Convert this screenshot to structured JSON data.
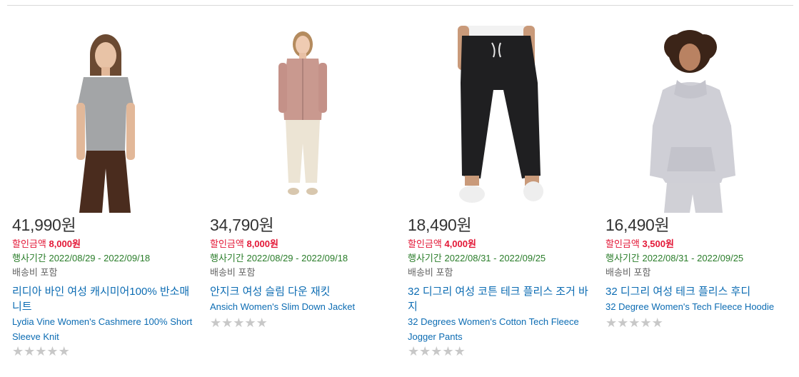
{
  "products": [
    {
      "price": "41,990원",
      "discount_label": "할인금액",
      "discount_value": "8,000원",
      "period_label": "행사기간",
      "period": "2022/08/29 - 2022/09/18",
      "shipping": "배송비 포함",
      "title_ko": "리디아 바인 여성 캐시미어100% 반소매 니트",
      "title_en": "Lydia Vine Women's Cashmere 100% Short Sleeve Knit",
      "rating_stars": 0,
      "image_icon": "product-image-cashmere-knit"
    },
    {
      "price": "34,790원",
      "discount_label": "할인금액",
      "discount_value": "8,000원",
      "period_label": "행사기간",
      "period": "2022/08/29 - 2022/09/18",
      "shipping": "배송비 포함",
      "title_ko": "안지크 여성 슬림 다운 재킷",
      "title_en": "Ansich Women's Slim Down Jacket",
      "rating_stars": 0,
      "image_icon": "product-image-down-jacket"
    },
    {
      "price": "18,490원",
      "discount_label": "할인금액",
      "discount_value": "4,000원",
      "period_label": "행사기간",
      "period": "2022/08/31 - 2022/09/25",
      "shipping": "배송비 포함",
      "title_ko": "32 디그리 여성 코튼 테크 플리스 조거 바지",
      "title_en": "32 Degrees Women's Cotton Tech Fleece Jogger Pants",
      "rating_stars": 0,
      "image_icon": "product-image-jogger-pants"
    },
    {
      "price": "16,490원",
      "discount_label": "할인금액",
      "discount_value": "3,500원",
      "period_label": "행사기간",
      "period": "2022/08/31 - 2022/09/25",
      "shipping": "배송비 포함",
      "title_ko": "32 디그리 여성 테크 플리스 후디",
      "title_en": "32 Degree Women's Tech Fleece Hoodie",
      "rating_stars": 0,
      "image_icon": "product-image-fleece-hoodie"
    }
  ],
  "star_glyph": "★",
  "colors": {
    "price": "#333333",
    "discount": "#e31837",
    "period": "#2a7d2a",
    "shipping": "#666666",
    "link": "#0c6cb3",
    "star_empty": "#c8c8c8"
  }
}
